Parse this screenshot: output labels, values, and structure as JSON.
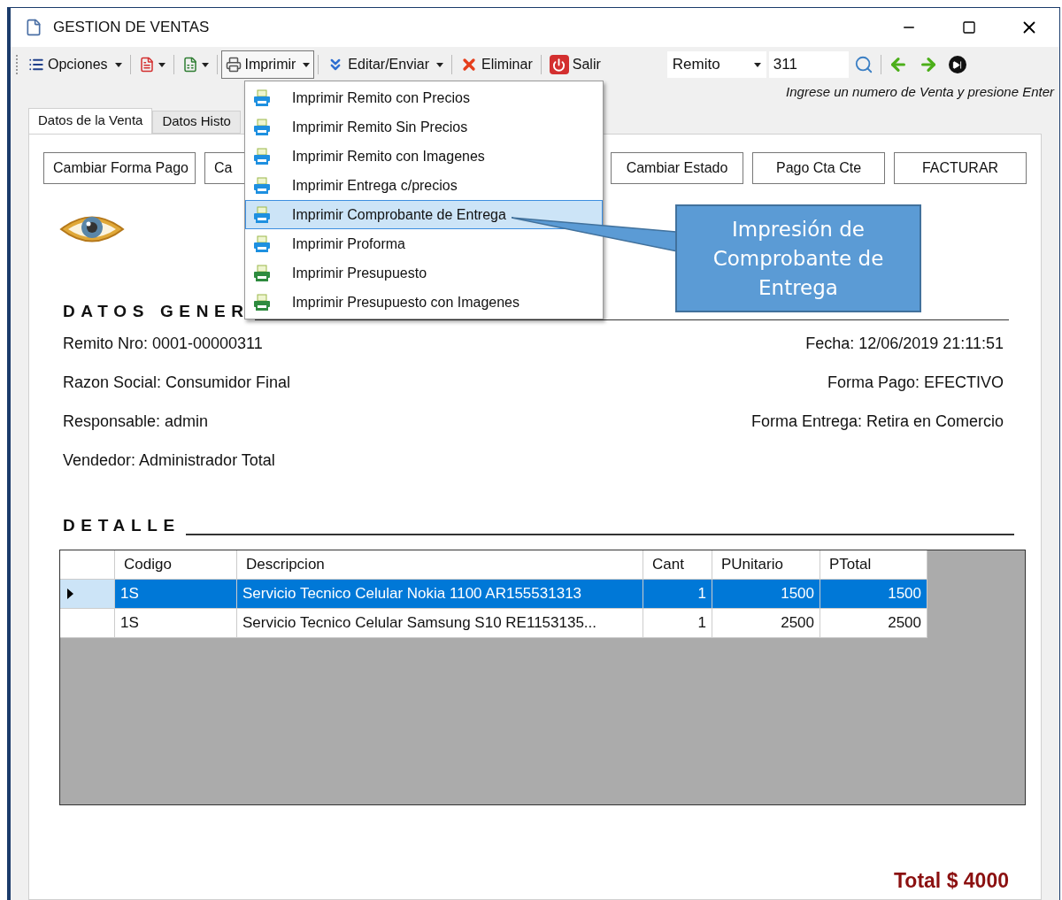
{
  "window": {
    "title": "GESTION DE VENTAS"
  },
  "toolbar": [
    {
      "kind": "dropdown",
      "label": "Opciones",
      "open": false
    },
    {
      "kind": "icondropdown",
      "open": false
    },
    {
      "kind": "icondropdown",
      "open": false
    },
    {
      "kind": "dropdown",
      "label": "Imprimir",
      "open": true
    },
    {
      "kind": "dropdown",
      "label": "Editar/Enviar",
      "open": false
    },
    {
      "kind": "button",
      "label": "Eliminar",
      "open": false
    },
    {
      "kind": "button",
      "label": "Salir",
      "open": false
    }
  ],
  "search": {
    "type": "Remito",
    "number": "311",
    "hint": "Ingrese un numero de Venta y presione Enter"
  },
  "tabs": [
    {
      "label": "Datos de la Venta",
      "selected": true
    },
    {
      "label": "Datos Histo",
      "selected": false
    }
  ],
  "action_buttons_left": [
    "Cambiar Forma Pago",
    "Ca"
  ],
  "action_buttons_right": [
    "Cambiar Estado",
    "Pago Cta Cte",
    "FACTURAR"
  ],
  "general": {
    "heading": "DATOS GENER",
    "rows": [
      {
        "left": "Remito Nro: 0001-00000311",
        "right": "Fecha: 12/06/2019 21:11:51"
      },
      {
        "left": "Razon Social: Consumidor Final",
        "right": "Forma Pago: EFECTIVO"
      },
      {
        "left": "Responsable: admin",
        "right": "Forma Entrega: Retira en Comercio"
      },
      {
        "left": "Vendedor: Administrador Total"
      }
    ]
  },
  "detail": {
    "heading": "DETALLE",
    "columns": [
      "Codigo",
      "Descripcion",
      "Cant",
      "PUnitario",
      "PTotal"
    ],
    "rows": [
      {
        "selected": true,
        "cells": [
          "1S",
          "Servicio Tecnico Celular Nokia 1100 AR155531313",
          "1",
          "1500",
          "1500"
        ]
      },
      {
        "selected": false,
        "cells": [
          "1S",
          "Servicio Tecnico Celular Samsung S10 RE1153135...",
          "1",
          "2500",
          "2500"
        ]
      }
    ]
  },
  "total": "Total $ 4000",
  "print_menu": [
    {
      "label": "Imprimir Remito con Precios",
      "kind": "remito",
      "selected": false
    },
    {
      "label": "Imprimir Remito Sin Precios",
      "kind": "remito",
      "selected": false
    },
    {
      "label": "Imprimir Remito con Imagenes",
      "kind": "remito",
      "selected": false
    },
    {
      "label": "Imprimir Entrega c/precios",
      "kind": "remito",
      "selected": false
    },
    {
      "label": "Imprimir Comprobante de Entrega",
      "kind": "remito",
      "selected": true
    },
    {
      "label": "Imprimir Proforma",
      "kind": "remito",
      "selected": false
    },
    {
      "label": "Imprimir Presupuesto",
      "kind": "presupuesto",
      "selected": false
    },
    {
      "label": "Imprimir Presupuesto con Imagenes",
      "kind": "presupuesto",
      "selected": false
    }
  ],
  "callout": "Impresión de Comprobante de Entrega"
}
